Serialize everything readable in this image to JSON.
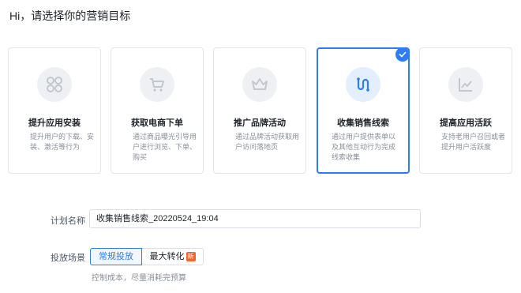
{
  "page": {
    "title": "Hi，请选择你的营销目标"
  },
  "cards": [
    {
      "label": "提升应用安装",
      "desc": "提升用户的下载、安装、激活等行为",
      "icon": "apps-grid-icon",
      "selected": false
    },
    {
      "label": "获取电商下单",
      "desc": "通过商品曝光引导用户进行浏览、下单、购买",
      "icon": "shopping-cart-icon",
      "selected": false
    },
    {
      "label": "推广品牌活动",
      "desc": "通过品牌活动获取用户访问落地页",
      "icon": "crown-icon",
      "selected": false
    },
    {
      "label": "收集销售线索",
      "desc": "通过用户提供表单以及其他互动行为完成线索收集",
      "icon": "route-icon",
      "selected": true
    },
    {
      "label": "提高应用活跃",
      "desc": "支持老用户召回或者提升用户活跃度",
      "icon": "trend-chart-icon",
      "selected": false
    }
  ],
  "form": {
    "plan_name_label": "计划名称",
    "plan_name_value": "收集销售线索_20220524_19:04",
    "scene_label": "投放场景",
    "scene_options": [
      {
        "label": "常规投放",
        "active": true
      },
      {
        "label": "最大转化",
        "badge": "新",
        "active": false
      }
    ],
    "scene_hint": "控制成本，尽量消耗完预算"
  },
  "colors": {
    "accent": "#2e7cf6",
    "badge": "#f5642d",
    "icon_gray": "#c4c8ce"
  }
}
